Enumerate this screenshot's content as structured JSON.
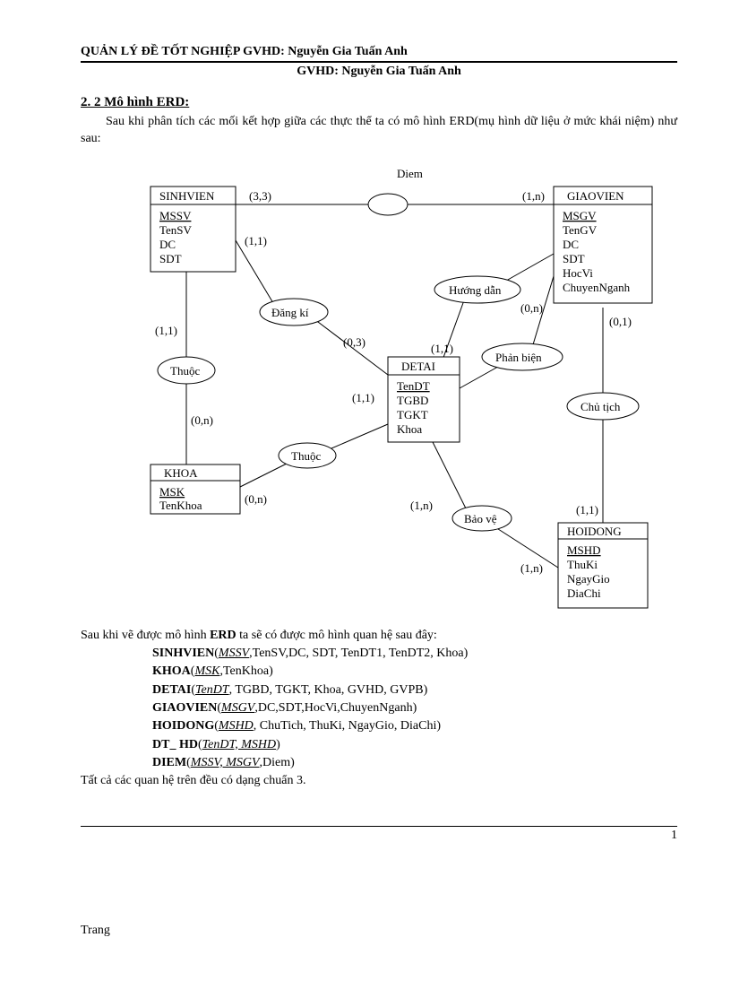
{
  "header": {
    "line1_left": "QUẢN LÝ ĐỀ TỐT NGHIỆP",
    "line1_right": "GVHD: Nguyễn Gia Tuấn Anh",
    "line2": "GVHD: Nguyễn Gia Tuấn Anh"
  },
  "section_title": "2. 2 Mô hình ERD:",
  "intro": "Sau khi phân tích các mối kết hợp giữa các thực thể ta có mô hình ERD(mụ hình dữ liệu ở mức khái niệm) như sau:",
  "diagram": {
    "entities": {
      "sinhvien": {
        "title": "SINHVIEN",
        "attrs": [
          "MSSV",
          "TenSV",
          "DC",
          "SDT"
        ],
        "key": "MSSV"
      },
      "giaovien": {
        "title": "GIAOVIEN",
        "attrs": [
          "MSGV",
          "TenGV",
          "DC",
          "SDT",
          "HocVi",
          "ChuyenNganh"
        ],
        "key": "MSGV"
      },
      "detai": {
        "title": "DETAI",
        "attrs": [
          "TenDT",
          "TGBD",
          "TGKT",
          "Khoa"
        ],
        "key": "TenDT"
      },
      "khoa": {
        "title": "KHOA",
        "attrs": [
          "MSK",
          "TenKhoa"
        ],
        "key": "MSK"
      },
      "hoidong": {
        "title": "HOIDONG",
        "attrs": [
          "MSHD",
          "ThuKi",
          "NgayGio",
          "DiaChi"
        ],
        "key": "MSHD"
      }
    },
    "relationships": {
      "diem_label_above": "Diem",
      "dangki": "Đăng kí",
      "thuoc": "Thuộc",
      "thuoc2": "Thuộc",
      "huongdan": "Hướng dẫn",
      "phanbien": "Phản biện",
      "chutich": "Chủ tịch",
      "baove": "Bảo vệ"
    },
    "cards": {
      "diem_sv": "(3,3)",
      "diem_gv": "(1,n)",
      "dangki_sv": "(1,1)",
      "dangki_dt": "(0,3)",
      "huongdan_gv": "(0,n)",
      "huongdan_dt": "(1,1)",
      "thuoc_sv": "(1,1)",
      "thuoc_khoa": "(0,n)",
      "thuoc2_dt": "(1,1)",
      "thuoc2_khoa": "(0,n)",
      "baove_dt": "(1,n)",
      "baove_hd": "(1,n)",
      "chutich_gv": "(0,1)",
      "chutich_hd": "(1,1)"
    }
  },
  "schema_intro": "Sau khi vẽ được mô hình ERD ta sẽ có được mô hình quan hệ sau đây:",
  "schema": [
    {
      "name": "SINHVIEN",
      "key": "MSSV",
      "rest": ",TenSV,DC, SDT, TenDT1, TenDT2, Khoa)"
    },
    {
      "name": "KHOA",
      "key": "MSK",
      "rest": ",TenKhoa)"
    },
    {
      "name": "DETAI",
      "key": "TenDT",
      "rest": ", TGBD, TGKT, Khoa, GVHD, GVPB)"
    },
    {
      "name": "GIAOVIEN",
      "key": "MSGV",
      "rest": ",DC,SDT,HocVi,ChuyenNganh)"
    },
    {
      "name": "HOIDONG",
      "key": "MSHD",
      "rest": ", ChuTich, ThuKi, NgayGio, DiaChi)"
    },
    {
      "name": "DT_ HD",
      "key": "TenDT, MSHD",
      "rest": ")"
    },
    {
      "name": "DIEM",
      "key": "MSSV, MSGV",
      "rest": ",Diem)"
    }
  ],
  "schema_note": "Tất cả các quan hệ trên đều có dạng chuẩn 3.",
  "footer": {
    "page_label": "Trang",
    "page_num": "1"
  }
}
